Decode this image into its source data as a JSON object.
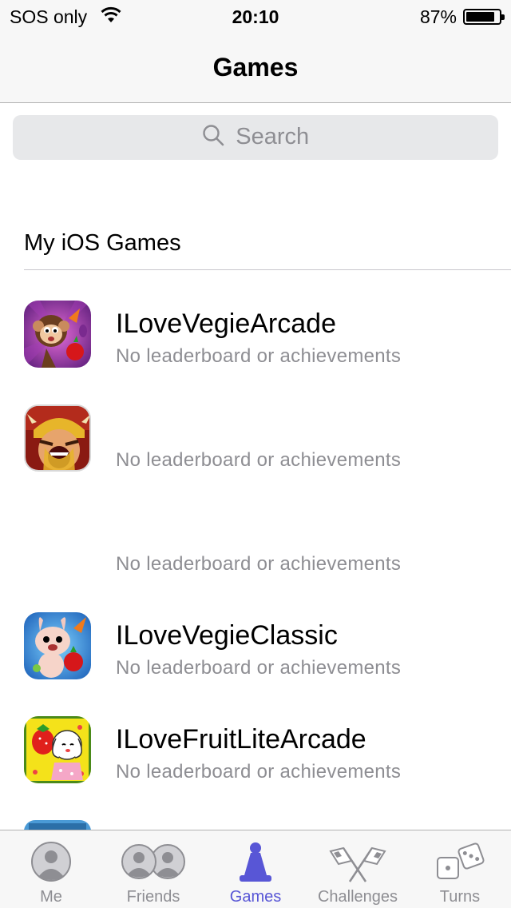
{
  "status_bar": {
    "carrier": "SOS only",
    "time": "20:10",
    "battery_percent": "87%",
    "battery_level": 0.87
  },
  "nav": {
    "title": "Games"
  },
  "search": {
    "placeholder": "Search"
  },
  "section": {
    "header": "My iOS Games"
  },
  "games": [
    {
      "title": "ILoveVegieArcade",
      "subtitle": "No leaderboard or achievements",
      "icon": "monkey-vegetable-icon"
    },
    {
      "title": "",
      "subtitle": "No leaderboard or achievements",
      "icon": "barbarian-icon"
    },
    {
      "title": "",
      "subtitle": "No leaderboard or achievements",
      "icon": ""
    },
    {
      "title": "ILoveVegieClassic",
      "subtitle": "No leaderboard or achievements",
      "icon": "bunny-vegetable-icon"
    },
    {
      "title": "ILoveFruitLiteArcade",
      "subtitle": "No leaderboard or achievements",
      "icon": "strawberry-character-icon"
    }
  ],
  "tabs": [
    {
      "label": "Me",
      "icon": "person-icon",
      "active": false
    },
    {
      "label": "Friends",
      "icon": "people-icon",
      "active": false
    },
    {
      "label": "Games",
      "icon": "game-piece-icon",
      "active": true
    },
    {
      "label": "Challenges",
      "icon": "crossed-flags-icon",
      "active": false
    },
    {
      "label": "Turns",
      "icon": "dice-icon",
      "active": false
    }
  ],
  "colors": {
    "accent": "#5856d6",
    "secondary_text": "#8e8e93",
    "bar_background": "#f7f7f7",
    "search_background": "#e7e8ea"
  }
}
